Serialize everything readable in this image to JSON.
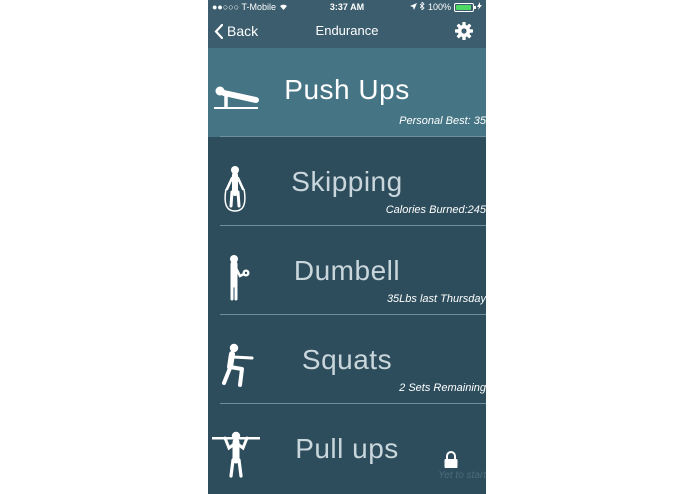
{
  "status_bar": {
    "carrier": "T-Mobile",
    "time": "3:37 AM",
    "battery": "100%"
  },
  "nav": {
    "back_label": "Back",
    "title": "Endurance"
  },
  "exercises": [
    {
      "name": "Push Ups",
      "detail": "Personal Best: 35",
      "icon": "push-up-icon",
      "highlighted": true
    },
    {
      "name": "Skipping",
      "detail": "Calories Burned:245",
      "icon": "skipping-icon"
    },
    {
      "name": "Dumbell",
      "detail": "35Lbs last Thursday",
      "icon": "dumbbell-icon"
    },
    {
      "name": "Squats",
      "detail": "2 Sets Remaining",
      "icon": "squat-icon"
    },
    {
      "name": "Pull ups",
      "detail": "Yet to start",
      "icon": "pull-up-icon",
      "locked": true
    }
  ],
  "colors": {
    "background": "#2d4d5c",
    "highlight": "#457584",
    "nav": "#3b5d6d",
    "battery": "#4cd964"
  }
}
